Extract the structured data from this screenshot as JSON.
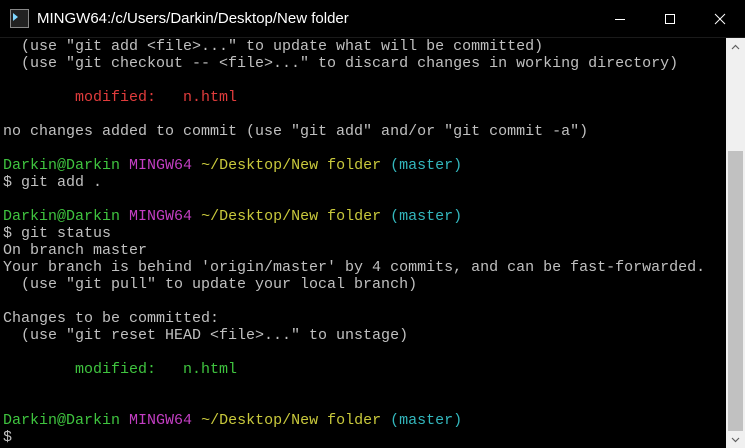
{
  "window": {
    "title": "MINGW64:/c/Users/Darkin/Desktop/New folder",
    "icons": {
      "app": "git-bash-icon",
      "minimize": "minimize-icon",
      "maximize": "maximize-icon",
      "close": "close-icon"
    }
  },
  "terminal": {
    "lines": [
      {
        "l1": "  (use \"git add <file>...\" to update what will be committed)"
      },
      {
        "l2": "  (use \"git checkout -- <file>...\" to discard changes in working directory)"
      },
      {
        "l3": ""
      },
      {
        "l4a": "        modified:   ",
        "l4b": "n.html"
      },
      {
        "l5": ""
      },
      {
        "l6": "no changes added to commit (use \"git add\" and/or \"git commit -a\")"
      },
      {
        "l7": ""
      },
      {
        "p1_user": "Darkin@Darkin",
        "p1_sys": "MINGW64",
        "p1_path": "~/Desktop/New folder",
        "p1_branch": "(master)"
      },
      {
        "c1": "$ git add ."
      },
      {
        "l8": ""
      },
      {
        "p2_user": "Darkin@Darkin",
        "p2_sys": "MINGW64",
        "p2_path": "~/Desktop/New folder",
        "p2_branch": "(master)"
      },
      {
        "c2": "$ git status"
      },
      {
        "l9": "On branch master"
      },
      {
        "l10": "Your branch is behind 'origin/master' by 4 commits, and can be fast-forwarded."
      },
      {
        "l11": "  (use \"git pull\" to update your local branch)"
      },
      {
        "l12": ""
      },
      {
        "l13": "Changes to be committed:"
      },
      {
        "l14": "  (use \"git reset HEAD <file>...\" to unstage)"
      },
      {
        "l15": ""
      },
      {
        "l16a": "        modified:   ",
        "l16b": "n.html"
      },
      {
        "l17": ""
      },
      {
        "l18": ""
      },
      {
        "p3_user": "Darkin@Darkin",
        "p3_sys": "MINGW64",
        "p3_path": "~/Desktop/New folder",
        "p3_branch": "(master)"
      },
      {
        "c3": "$"
      }
    ]
  },
  "colors": {
    "background": "#000000",
    "text": "#c0c0c0",
    "modified_unstaged": "#e03c3c",
    "modified_staged": "#3fc43f",
    "prompt_user": "#3fc43f",
    "prompt_system": "#c33ec3",
    "prompt_path": "#c9c93c",
    "prompt_branch": "#33b7bd"
  }
}
